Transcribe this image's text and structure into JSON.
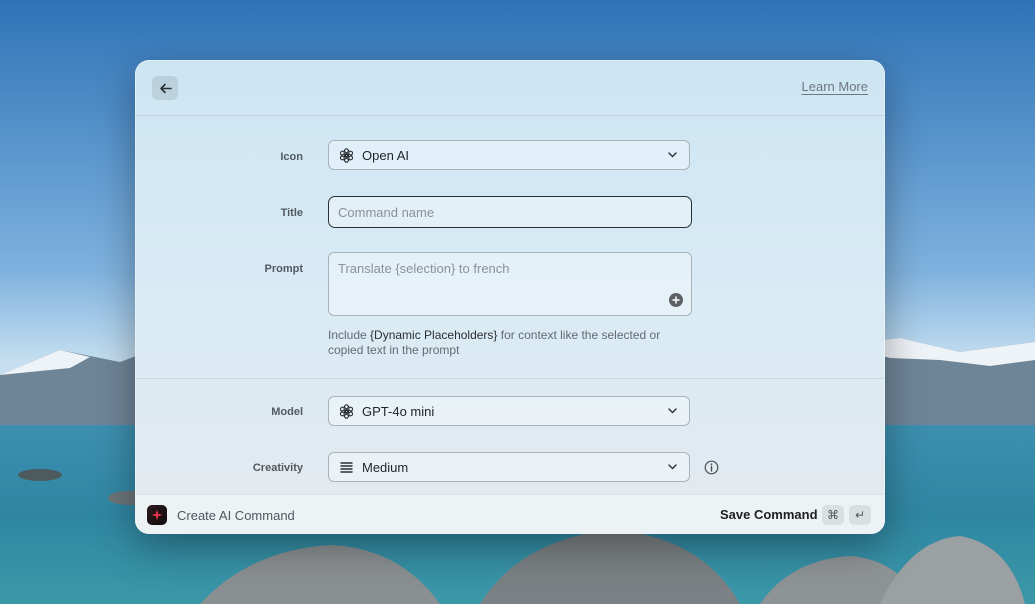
{
  "header": {
    "back_icon": "arrow-left-icon",
    "learn_more_label": "Learn More"
  },
  "form": {
    "icon": {
      "label": "Icon",
      "value": "Open AI",
      "icon": "openai-icon"
    },
    "title": {
      "label": "Title",
      "placeholder": "Command name",
      "value": ""
    },
    "prompt": {
      "label": "Prompt",
      "placeholder": "Translate {selection} to french",
      "add_icon": "plus-circle-icon"
    },
    "hint": {
      "prefix": "Include ",
      "highlight": "{Dynamic Placeholders}",
      "suffix": " for context like the selected or copied text in the prompt"
    },
    "model": {
      "label": "Model",
      "value": "GPT-4o mini",
      "icon": "openai-icon"
    },
    "creativity": {
      "label": "Creativity",
      "value": "Medium",
      "icon": "bars-icon",
      "info_icon": "info-icon"
    }
  },
  "footer": {
    "title": "Create AI Command",
    "save_label": "Save Command",
    "shortcut_cmd": "⌘",
    "shortcut_enter": "↵"
  },
  "colors": {
    "accent_border": "#2b3034",
    "app_icon_accent": "#e8334a"
  }
}
